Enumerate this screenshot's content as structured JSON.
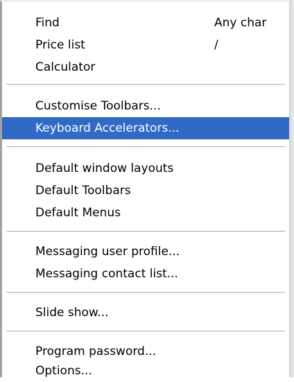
{
  "menu": {
    "items": [
      {
        "label": "Find",
        "shortcut": "Any char"
      },
      {
        "label": "Price list",
        "shortcut": "/"
      },
      {
        "label": "Calculator",
        "shortcut": ""
      },
      {
        "label": "Customise Toolbars...",
        "shortcut": ""
      },
      {
        "label": "Keyboard Accelerators...",
        "shortcut": ""
      },
      {
        "label": "Default window layouts",
        "shortcut": ""
      },
      {
        "label": "Default Toolbars",
        "shortcut": ""
      },
      {
        "label": "Default Menus",
        "shortcut": ""
      },
      {
        "label": "Messaging user profile...",
        "shortcut": ""
      },
      {
        "label": "Messaging contact list...",
        "shortcut": ""
      },
      {
        "label": "Slide show...",
        "shortcut": ""
      },
      {
        "label": "Program password...",
        "shortcut": ""
      },
      {
        "label": "Options...",
        "shortcut": ""
      }
    ],
    "highlighted_item": "Keyboard Accelerators...",
    "highlight_color": "#316ac5"
  }
}
